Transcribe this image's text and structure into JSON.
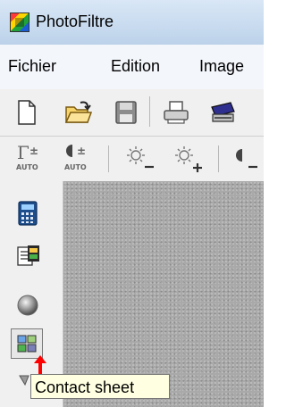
{
  "app": {
    "title": "PhotoFiltre"
  },
  "menu": {
    "items": [
      "Fichier",
      "Edition",
      "Image"
    ]
  },
  "toolbar2": {
    "auto1": "AUTO",
    "auto2": "AUTO"
  },
  "tooltip": {
    "text": "Contact sheet"
  },
  "colors": {
    "title_bg": "#c4d8ee",
    "menu_bg": "#f3f6fb",
    "toolbar_bg": "#f0f0f0",
    "workspace_bg": "#a9a9a9",
    "tooltip_bg": "#ffffe1",
    "arrow": "#ff0000"
  },
  "icons": {
    "toolbar1": [
      "new-document-icon",
      "open-folder-icon",
      "save-icon",
      "print-icon",
      "scanner-icon"
    ],
    "toolbar2": [
      "gamma-auto-icon",
      "contrast-auto-icon",
      "brightness-minus-icon",
      "brightness-plus-icon",
      "contrast-minus-icon"
    ],
    "left_panel": [
      "calculator-icon",
      "film-strip-icon",
      "sphere-icon",
      "contact-sheet-icon",
      "more-icon"
    ]
  }
}
